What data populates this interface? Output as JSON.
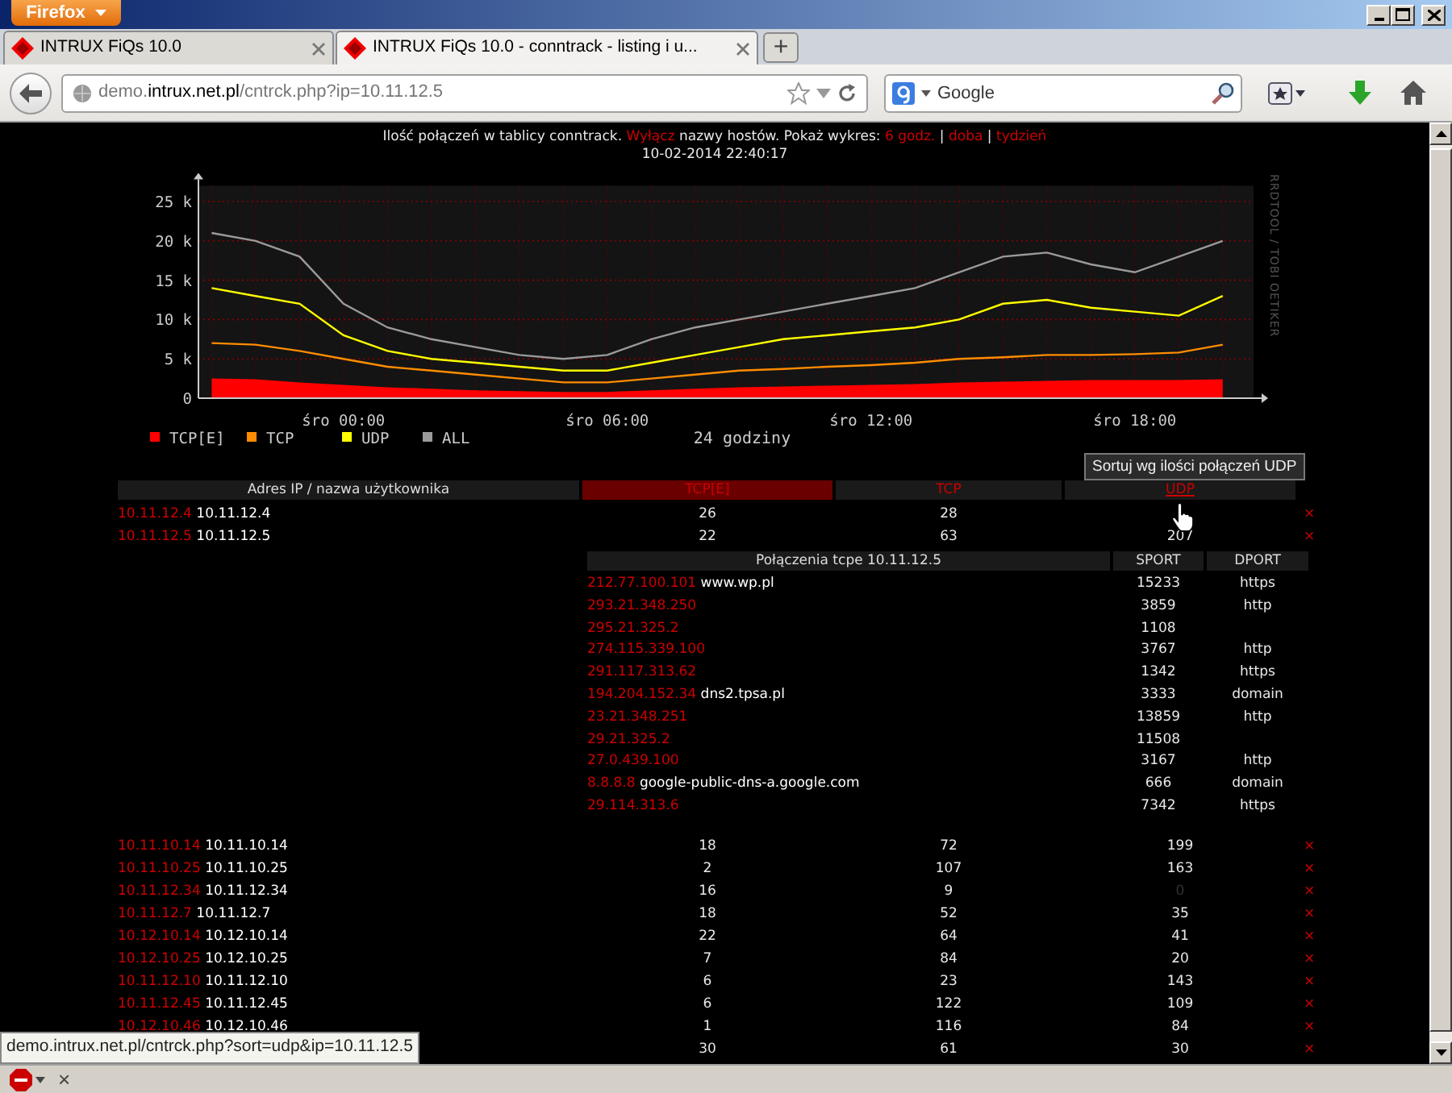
{
  "browser": {
    "menu_button": "Firefox",
    "tabs": [
      {
        "title": "INTRUX FiQs 10.0",
        "selected": false
      },
      {
        "title": "INTRUX FiQs 10.0 - conntrack - listing i u...",
        "selected": true
      }
    ],
    "new_tab": "+",
    "url": "demo.**intrux.net.pl**/cntrck.php?ip=10.11.12.5",
    "search_placeholder": "Google",
    "status_url": "demo.intrux.net.pl/cntrck.php?sort=udp&ip=10.11.12.5",
    "addon_close": "×"
  },
  "header": {
    "parts": [
      {
        "kind": "text",
        "text": "Ilość połączeń w tablicy conntrack. "
      },
      {
        "kind": "link",
        "text": "Wyłącz"
      },
      {
        "kind": "text",
        "text": " nazwy hostów. Pokaż wykres: "
      },
      {
        "kind": "link",
        "text": "6 godz."
      },
      {
        "kind": "text",
        "text": " | "
      },
      {
        "kind": "link",
        "text": "doba"
      },
      {
        "kind": "text",
        "text": " | "
      },
      {
        "kind": "link",
        "text": "tydzień"
      }
    ],
    "timestamp": "10-02-2014 22:40:17"
  },
  "graph": {
    "credit": "RRDTOOL / TOBI OETIKER",
    "chart_data": {
      "type": "line",
      "xlabel": "24 godziny",
      "categories": [
        null,
        null,
        null,
        "śro 00:00",
        null,
        null,
        null,
        null,
        null,
        "śro 06:00",
        null,
        null,
        null,
        null,
        null,
        "śro 12:00",
        null,
        null,
        null,
        null,
        null,
        "śro 18:00",
        null,
        null
      ],
      "ylim": [
        0,
        27000
      ],
      "yticks": [
        {
          "value": 0,
          "label": "0"
        },
        {
          "value": 5000,
          "label": "5 k"
        },
        {
          "value": 10000,
          "label": "10 k"
        },
        {
          "value": 15000,
          "label": "15 k"
        },
        {
          "value": 20000,
          "label": "20 k"
        },
        {
          "value": 25000,
          "label": "25 k"
        }
      ],
      "grid": true,
      "legend": true,
      "series": [
        {
          "name": "TCP[E]",
          "type": "area",
          "color": "#ff0000",
          "values": [
            2500,
            2400,
            2000,
            1700,
            1400,
            1200,
            1000,
            900,
            800,
            800,
            1000,
            1200,
            1400,
            1500,
            1600,
            1700,
            1800,
            2000,
            2100,
            2200,
            2300,
            2300,
            2300,
            2400
          ]
        },
        {
          "name": "TCP",
          "type": "line",
          "color": "#ff8c00",
          "values": [
            7000,
            6800,
            6000,
            5000,
            4000,
            3500,
            3000,
            2500,
            2000,
            2000,
            2500,
            3000,
            3500,
            3700,
            4000,
            4200,
            4500,
            5000,
            5200,
            5500,
            5500,
            5600,
            5800,
            6800
          ]
        },
        {
          "name": "UDP",
          "type": "line",
          "color": "#ffff00",
          "values": [
            14000,
            13000,
            12000,
            8000,
            6000,
            5000,
            4500,
            4000,
            3500,
            3500,
            4500,
            5500,
            6500,
            7500,
            8000,
            8500,
            9000,
            10000,
            12000,
            12500,
            11500,
            11000,
            10500,
            13000
          ]
        },
        {
          "name": "ALL",
          "type": "line",
          "color": "#9a9a9a",
          "values": [
            21000,
            20000,
            18000,
            12000,
            9000,
            7500,
            6500,
            5500,
            5000,
            5500,
            7500,
            9000,
            10000,
            11000,
            12000,
            13000,
            14000,
            16000,
            18000,
            18500,
            17000,
            16000,
            18000,
            20000
          ]
        }
      ]
    }
  },
  "table": {
    "columns": [
      {
        "label": "Adres IP / nazwa użytkownika",
        "selected": false,
        "hovered": false
      },
      {
        "label": "TCP[E]",
        "selected": true,
        "hovered": false
      },
      {
        "label": "TCP",
        "selected": false,
        "hovered": false
      },
      {
        "label": "UDP",
        "selected": false,
        "hovered": true
      }
    ],
    "tooltip": "Sortuj wg ilości połączeń UDP",
    "rows": [
      {
        "ip": "10.11.12.4",
        "name": "10.11.12.4",
        "tcpe": "26",
        "tcp": "28",
        "delete": "×"
      },
      {
        "ip": "10.11.12.5",
        "name": "10.11.12.5",
        "tcpe": "22",
        "tcp": "63",
        "udp": "207",
        "udp_dimmed": false,
        "delete": "×",
        "details": {
          "title": "Połączenia tcpe 10.11.12.5",
          "columns": [
            "SPORT",
            "DPORT"
          ],
          "rows": [
            {
              "ip": "212.77.100.101",
              "host": "www.wp.pl",
              "sport": "15233",
              "dport": "https"
            },
            {
              "ip": "293.21.348.250",
              "sport": "3859",
              "dport": "http"
            },
            {
              "ip": "295.21.325.2",
              "sport": "1108"
            },
            {
              "ip": "274.115.339.100",
              "sport": "3767",
              "dport": "http"
            },
            {
              "ip": "291.117.313.62",
              "sport": "1342",
              "dport": "https"
            },
            {
              "ip": "194.204.152.34",
              "host": "dns2.tpsa.pl",
              "sport": "3333",
              "dport": "domain"
            },
            {
              "ip": "23.21.348.251",
              "sport": "13859",
              "dport": "http"
            },
            {
              "ip": "29.21.325.2",
              "sport": "11508"
            },
            {
              "ip": "27.0.439.100",
              "sport": "3167",
              "dport": "http"
            },
            {
              "ip": "8.8.8.8",
              "host": "google-public-dns-a.google.com",
              "sport": "666",
              "dport": "domain"
            },
            {
              "ip": "29.114.313.6",
              "sport": "7342",
              "dport": "https"
            }
          ]
        }
      },
      {
        "ip": "10.11.10.14",
        "name": "10.11.10.14",
        "tcpe": "18",
        "tcp": "72",
        "udp": "199",
        "udp_dimmed": false,
        "delete": "×"
      },
      {
        "ip": "10.11.10.25",
        "name": "10.11.10.25",
        "tcpe": "2",
        "tcp": "107",
        "udp": "163",
        "udp_dimmed": false,
        "delete": "×"
      },
      {
        "ip": "10.11.12.34",
        "name": "10.11.12.34",
        "tcpe": "16",
        "tcp": "9",
        "udp": "0",
        "udp_dimmed": true,
        "delete": "×"
      },
      {
        "ip": "10.11.12.7",
        "name": "10.11.12.7",
        "tcpe": "18",
        "tcp": "52",
        "udp": "35",
        "udp_dimmed": false,
        "delete": "×"
      },
      {
        "ip": "10.12.10.14",
        "name": "10.12.10.14",
        "tcpe": "22",
        "tcp": "64",
        "udp": "41",
        "udp_dimmed": false,
        "delete": "×"
      },
      {
        "ip": "10.12.10.25",
        "name": "10.12.10.25",
        "tcpe": "7",
        "tcp": "84",
        "udp": "20",
        "udp_dimmed": false,
        "delete": "×"
      },
      {
        "ip": "10.11.12.10",
        "name": "10.11.12.10",
        "tcpe": "6",
        "tcp": "23",
        "udp": "143",
        "udp_dimmed": false,
        "delete": "×"
      },
      {
        "ip": "10.11.12.45",
        "name": "10.11.12.45",
        "tcpe": "6",
        "tcp": "122",
        "udp": "109",
        "udp_dimmed": false,
        "delete": "×"
      },
      {
        "ip": "10.12.10.46",
        "name": "10.12.10.46",
        "tcpe": "1",
        "tcp": "116",
        "udp": "84",
        "udp_dimmed": false,
        "delete": "×"
      },
      {
        "tcpe": "30",
        "tcp": "61",
        "udp": "30",
        "udp_dimmed": false,
        "delete": "×"
      }
    ]
  }
}
